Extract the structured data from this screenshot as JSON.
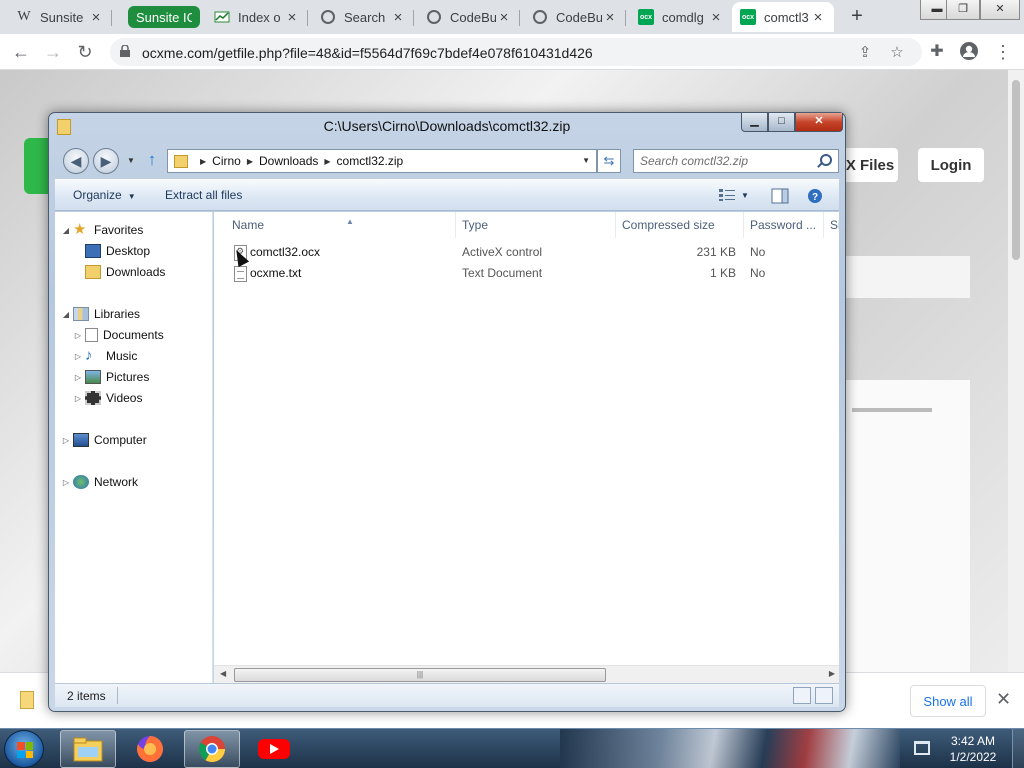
{
  "browser": {
    "tabs": [
      {
        "title": "Sunsite",
        "icon": "wikipedia-icon",
        "active": false
      },
      {
        "title": "Sunsite ICM",
        "icon": "",
        "active": false,
        "group": true
      },
      {
        "title": "Index o",
        "icon": "chart-icon",
        "active": false
      },
      {
        "title": "Search",
        "icon": "globe-icon",
        "active": false
      },
      {
        "title": "CodeBu",
        "icon": "globe-icon",
        "active": false
      },
      {
        "title": "CodeBu",
        "icon": "globe-icon",
        "active": false
      },
      {
        "title": "comdlg",
        "icon": "ocx-icon",
        "active": false
      },
      {
        "title": "comctl3",
        "icon": "ocx-icon",
        "active": true
      }
    ],
    "tab_close": "×",
    "new_tab": "+",
    "url": "ocxme.com/getfile.php?file=48&id=f5564d7f69c7bdef4e078f610431d426",
    "favicon_text": "W",
    "ocx_text": "ocx"
  },
  "page": {
    "files_button": "X Files",
    "login_button": "Login"
  },
  "download_shelf": {
    "show_all": "Show all"
  },
  "taskbar": {
    "time": "3:42 AM",
    "date": "1/2/2022"
  },
  "explorer": {
    "title": "C:\\Users\\Cirno\\Downloads\\comctl32.zip",
    "breadcrumb": [
      "Cirno",
      "Downloads",
      "comctl32.zip"
    ],
    "search_placeholder": "Search comctl32.zip",
    "commands": {
      "organize": "Organize",
      "extract": "Extract all files"
    },
    "tree": {
      "favorites": "Favorites",
      "desktop": "Desktop",
      "downloads": "Downloads",
      "libraries": "Libraries",
      "documents": "Documents",
      "music": "Music",
      "pictures": "Pictures",
      "videos": "Videos",
      "computer": "Computer",
      "network": "Network"
    },
    "columns": [
      "Name",
      "Type",
      "Compressed size",
      "Password ...",
      "Si"
    ],
    "files": [
      {
        "name": "comctl32.ocx",
        "type": "ActiveX control",
        "size": "231 KB",
        "password": "No"
      },
      {
        "name": "ocxme.txt",
        "type": "Text Document",
        "size": "1 KB",
        "password": "No"
      }
    ],
    "status": "2 items"
  },
  "colors": {
    "chrome_tabstrip": "#dee1e6",
    "tab_group": "#1e8e3e",
    "link_blue": "#1a73e8",
    "aero_frame": "#c5d4e6",
    "close_red": "#c6452a"
  }
}
